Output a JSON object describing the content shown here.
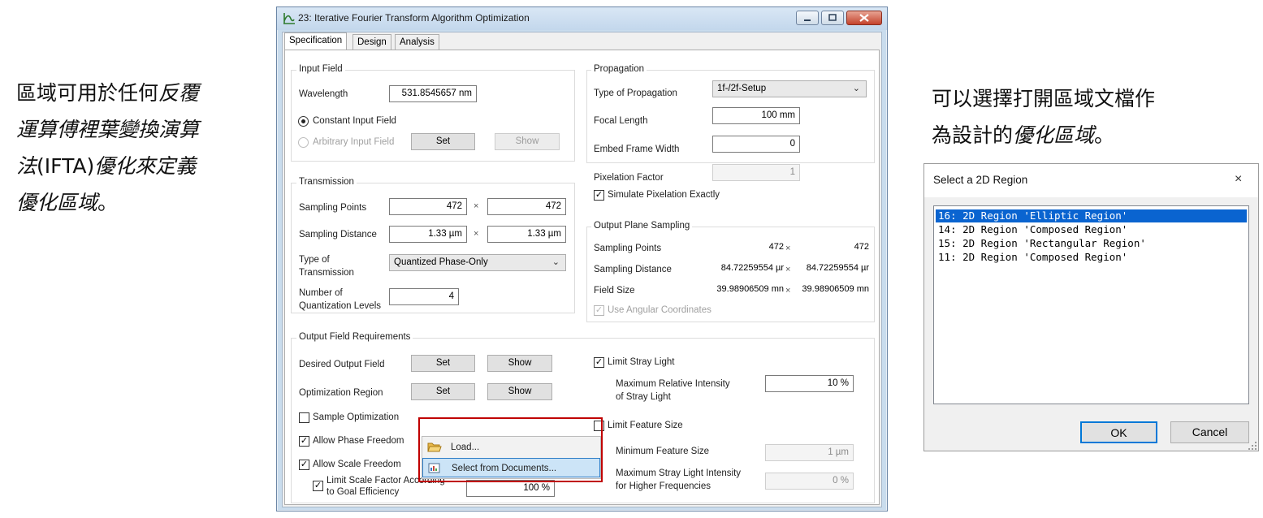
{
  "annotations": {
    "left": {
      "line1_plain": "區域可用於任何",
      "line1_italic": "反覆",
      "line2_italic": "運算傅裡葉變換演算",
      "line3_italic_prefix": "法",
      "line3_plain": "(IFTA)",
      "line3_italic": "優化來定義",
      "line4_italic": "優化區域",
      "line4_plain": "。"
    },
    "right": {
      "line1_plain": "可以選擇打開區域文檔作",
      "line2_plain": "為設計的",
      "line2_italic": "優化區域",
      "line2_end": "。"
    }
  },
  "window": {
    "title": "23: Iterative Fourier Transform Algorithm Optimization",
    "tabs": [
      "Specification",
      "Design",
      "Analysis"
    ],
    "active_tab": "Specification"
  },
  "input_field": {
    "group_label": "Input Field",
    "wavelength_label": "Wavelength",
    "wavelength_value": "531.8545657 nm",
    "constant_label": "Constant Input Field",
    "arbitrary_label": "Arbitrary Input Field",
    "set_label": "Set",
    "show_label": "Show"
  },
  "transmission": {
    "group_label": "Transmission",
    "sampling_points_label": "Sampling Points",
    "sampling_points_x": "472",
    "sampling_points_y": "472",
    "sampling_distance_label": "Sampling Distance",
    "sampling_distance_x": "1.33 µm",
    "sampling_distance_y": "1.33 µm",
    "type_label_1": "Type of",
    "type_label_2": "Transmission",
    "type_value": "Quantized Phase-Only",
    "levels_label_1": "Number of",
    "levels_label_2": "Quantization Levels",
    "levels_value": "4",
    "times": "×"
  },
  "propagation": {
    "group_label": "Propagation",
    "type_label": "Type of Propagation",
    "type_value": "1f-/2f-Setup",
    "focal_label": "Focal Length",
    "focal_value": "100 mm",
    "embed_label": "Embed Frame Width",
    "embed_value": "0",
    "pixelation_label": "Pixelation Factor",
    "pixelation_value": "1",
    "simulate_label": "Simulate Pixelation Exactly"
  },
  "output_plane": {
    "group_label": "Output Plane Sampling",
    "sampling_points_label": "Sampling Points",
    "sampling_points_x": "472",
    "sampling_points_y": "472",
    "sampling_distance_label": "Sampling Distance",
    "sampling_distance_x": "84.72259554 µr",
    "sampling_distance_y": "84.72259554 µr",
    "field_size_label": "Field Size",
    "field_size_x": "39.98906509 mn",
    "field_size_y": "39.98906509 mn",
    "angular_label": "Use Angular Coordinates",
    "times": "×"
  },
  "output_requirements": {
    "group_label": "Output Field Requirements",
    "desired_label": "Desired Output Field",
    "optimization_label": "Optimization Region",
    "set_label": "Set",
    "show_label": "Show",
    "sample_opt_label": "Sample Optimization",
    "phase_freedom_label": "Allow Phase Freedom",
    "scale_freedom_label": "Allow Scale Freedom",
    "limit_scale_label_1": "Limit Scale Factor According",
    "limit_scale_label_2": "to Goal Efficiency",
    "limit_scale_value": "100 %",
    "stray_label": "Limit Stray Light",
    "max_rel_label_1": "Maximum Relative Intensity",
    "max_rel_label_2": "of Stray Light",
    "max_rel_value": "10 %",
    "feature_label": "Limit Feature Size",
    "min_feature_label": "Minimum Feature Size",
    "min_feature_value": "1 µm",
    "max_stray_label_1": "Maximum Stray Light Intensity",
    "max_stray_label_2": "for Higher Frequencies",
    "max_stray_value": "0 %"
  },
  "context_menu": {
    "items": [
      "Load...",
      "Select from Documents..."
    ]
  },
  "region_dialog": {
    "title": "Select a 2D Region",
    "close": "×",
    "items": [
      "16: 2D Region 'Elliptic Region'",
      "14: 2D Region 'Composed Region'",
      "15: 2D Region 'Rectangular Region'",
      "11: 2D Region 'Composed Region'"
    ],
    "selected_index": 0,
    "ok_label": "OK",
    "cancel_label": "Cancel"
  },
  "colors": {
    "selection": "#0a64d0",
    "menu_highlight": "#cce4f7",
    "callout_border": "#c00000"
  }
}
